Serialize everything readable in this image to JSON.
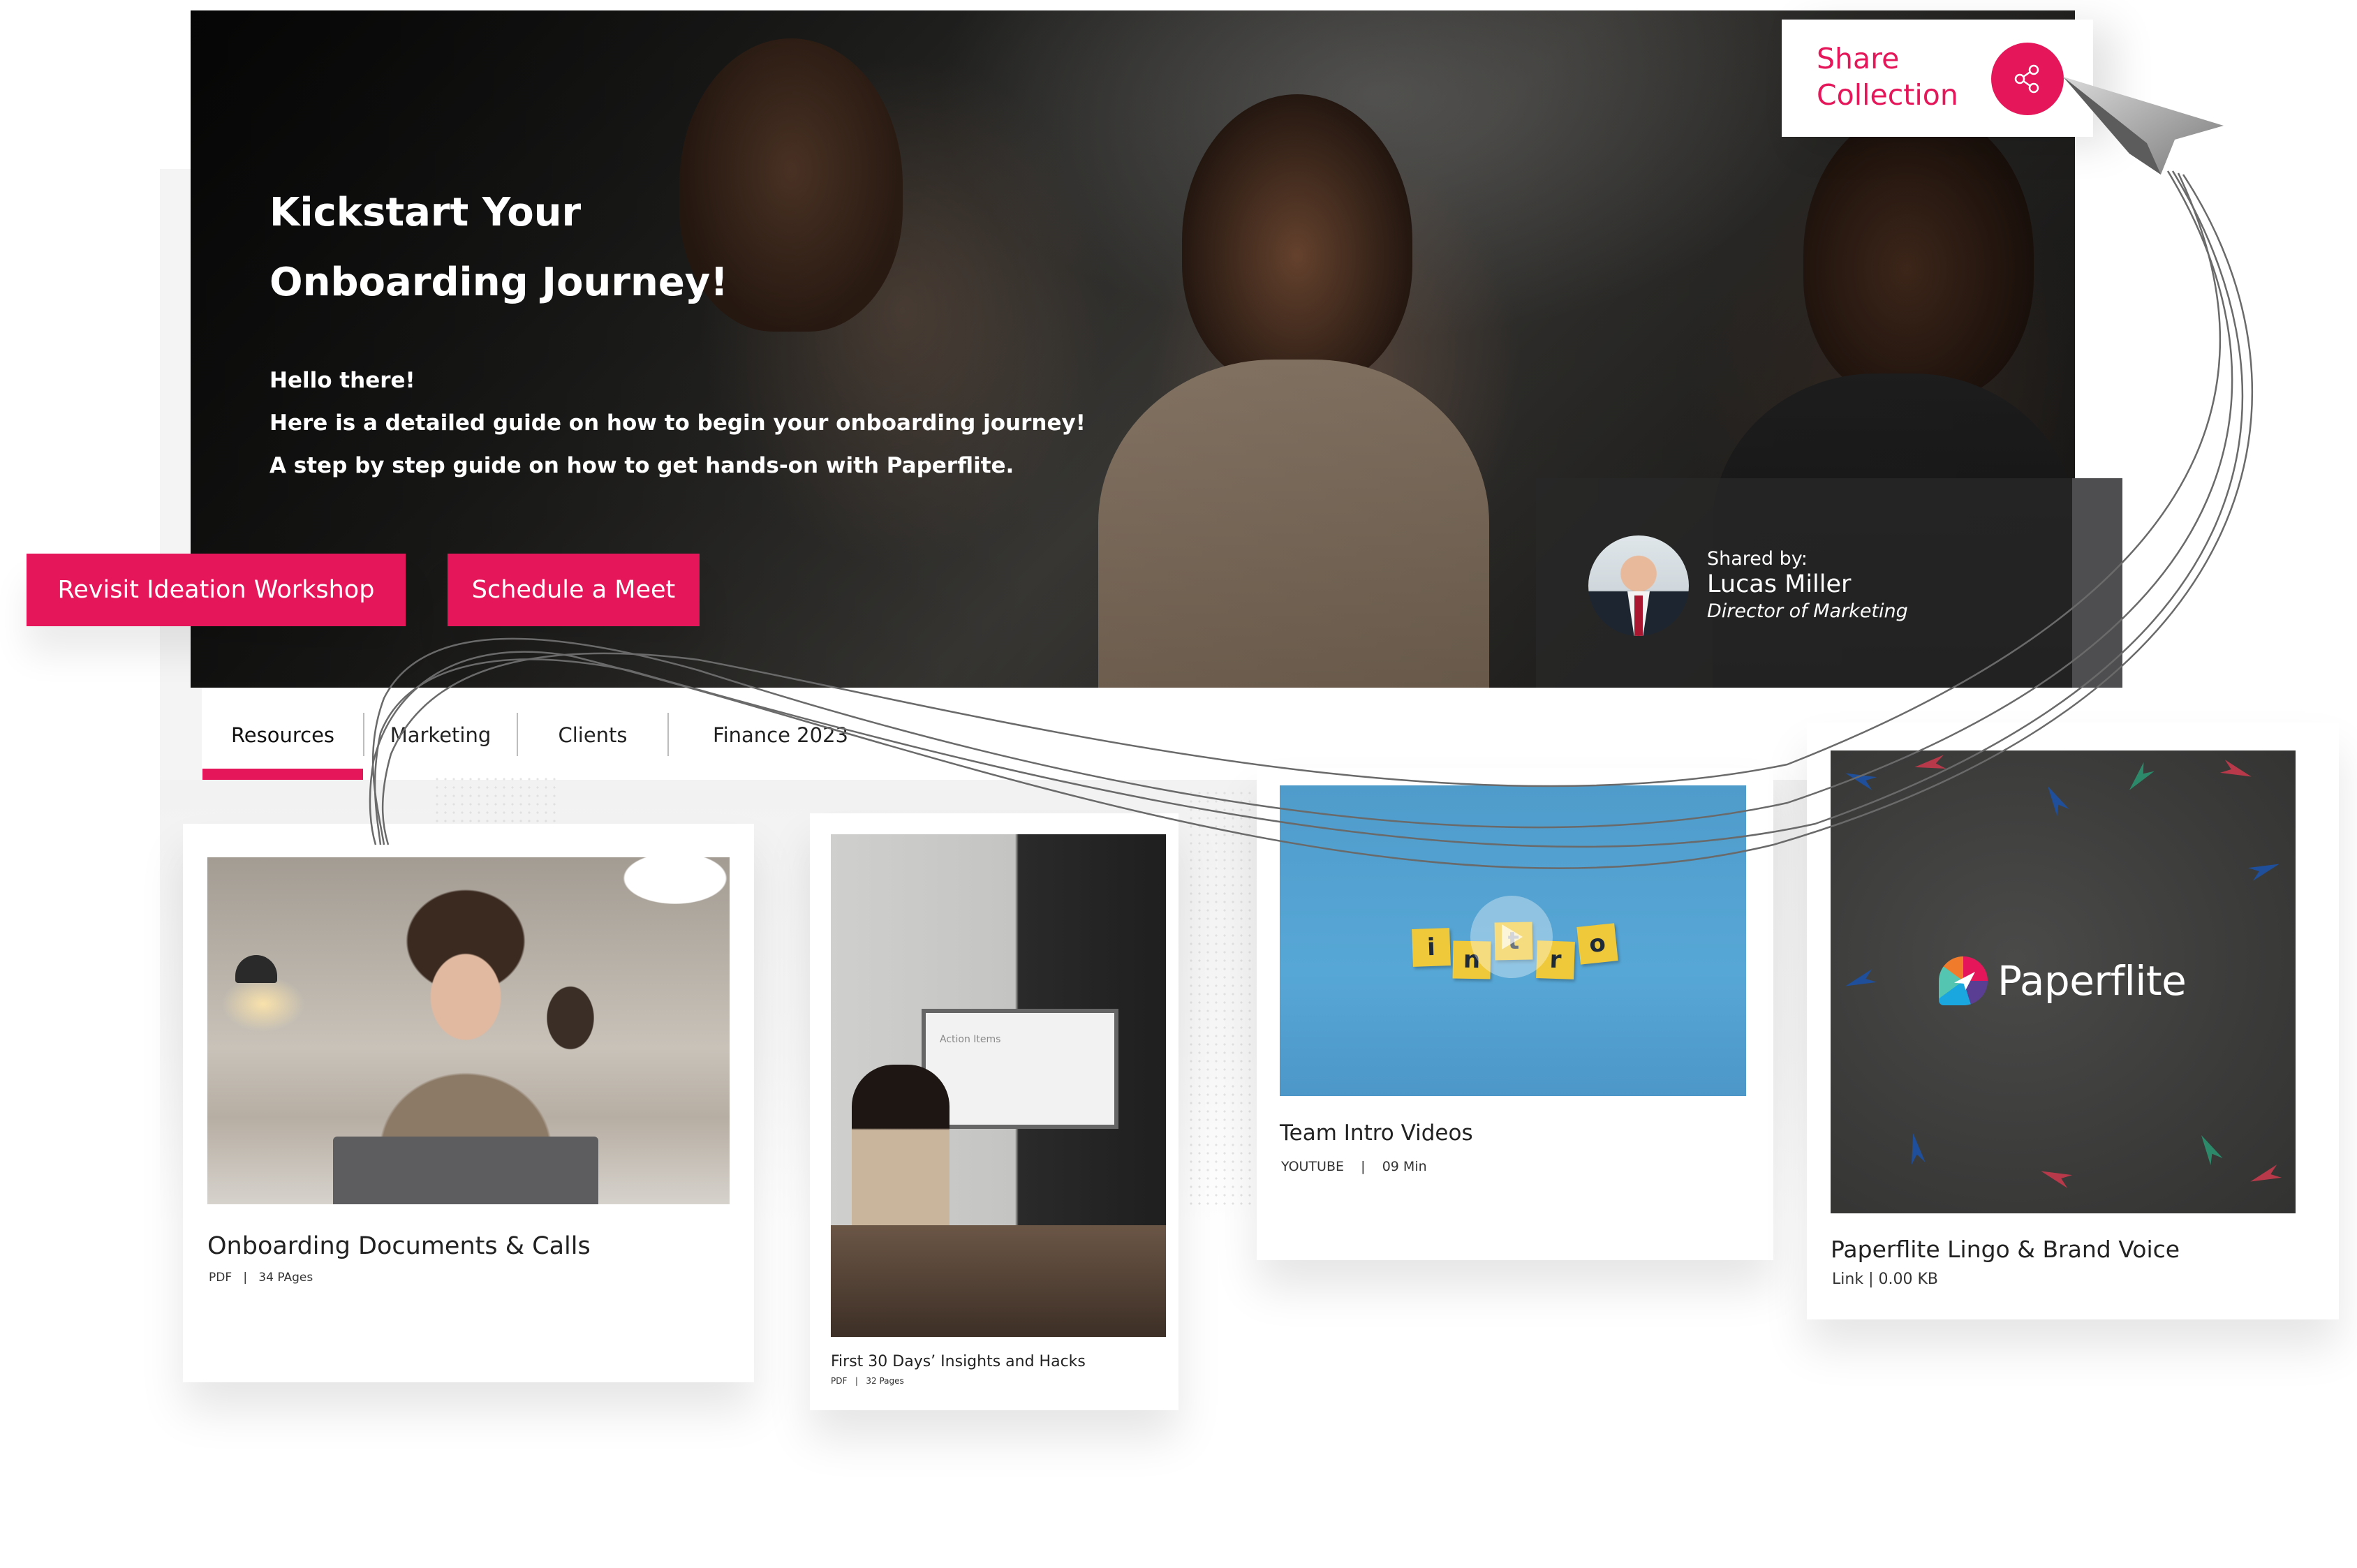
{
  "hero": {
    "title_line1": "Kickstart Your",
    "title_line2": "Onboarding Journey!",
    "body": [
      "Hello there!",
      "Here is a detailed guide on how to begin your onboarding journey!",
      "A step by step guide on how to get hands-on with Paperflite."
    ]
  },
  "share": {
    "label_line1": "Share",
    "label_line2": "Collection",
    "icon": "share-icon"
  },
  "cta_buttons": [
    {
      "label": "Revisit Ideation Workshop"
    },
    {
      "label": "Schedule a Meet"
    }
  ],
  "shared_by": {
    "label": "Shared by:",
    "name": "Lucas Miller",
    "role": "Director of Marketing"
  },
  "tabs": [
    {
      "label": "Resources",
      "active": true
    },
    {
      "label": "Marketing",
      "active": false
    },
    {
      "label": "Clients",
      "active": false
    },
    {
      "label": "Finance 2023",
      "active": false
    }
  ],
  "cards": [
    {
      "title": "Onboarding Documents & Calls",
      "type": "PDF",
      "detail": "34 PAges"
    },
    {
      "title": "First 30 Days’ Insights and Hacks",
      "type": "PDF",
      "detail": "32 Pages",
      "image_text": "Action Items"
    },
    {
      "title": "Team Intro Videos",
      "type": "YOUTUBE",
      "detail": "09 Min",
      "tiles": [
        "i",
        "n",
        "t",
        "r",
        "o"
      ]
    },
    {
      "title": "Paperflite Lingo & Brand Voice",
      "type": "Link",
      "detail": "0.00 KB",
      "logo_text": "Paperflite"
    }
  ],
  "colors": {
    "accent": "#e5175a",
    "intro_blue": "#57a7d6",
    "tile_yellow": "#f0c93a"
  }
}
